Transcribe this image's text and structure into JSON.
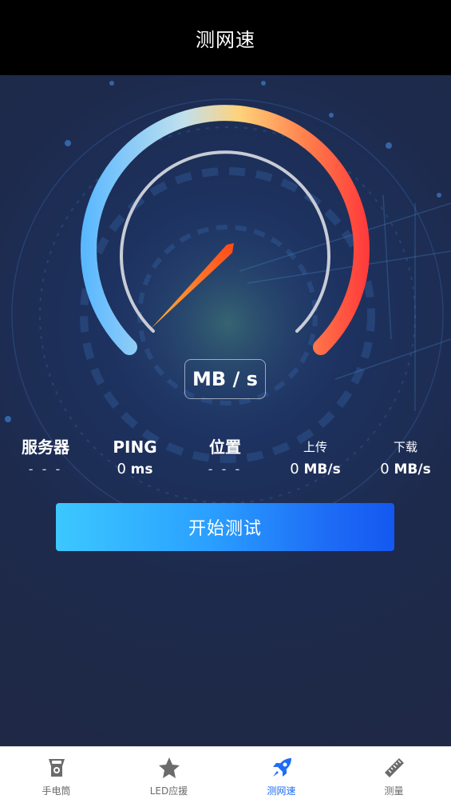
{
  "header": {
    "title": "测网速"
  },
  "gauge": {
    "unit": "MB / s",
    "needle_value": 0
  },
  "stats": {
    "server": {
      "label": "服务器",
      "value": "- - -"
    },
    "ping": {
      "label": "PING",
      "value": "0",
      "unit": "ms"
    },
    "location": {
      "label": "位置",
      "value": "- - -"
    },
    "upload": {
      "label": "上传",
      "value": "0",
      "unit": "MB/s"
    },
    "download": {
      "label": "下载",
      "value": "0",
      "unit": "MB/s"
    }
  },
  "start_button": {
    "label": "开始测试"
  },
  "tabs": [
    {
      "label": "手电筒",
      "icon": "flashlight-icon",
      "active": false
    },
    {
      "label": "LED应援",
      "icon": "star-icon",
      "active": false
    },
    {
      "label": "测网速",
      "icon": "rocket-icon",
      "active": true
    },
    {
      "label": "测量",
      "icon": "ruler-icon",
      "active": false
    }
  ],
  "colors": {
    "accent": "#1e6cf5",
    "background": "#1f2a48",
    "gauge_start": "#5ab8ff",
    "gauge_mid": "#ffd27a",
    "gauge_end": "#ff3b3b",
    "needle": "#ff7a1a"
  }
}
